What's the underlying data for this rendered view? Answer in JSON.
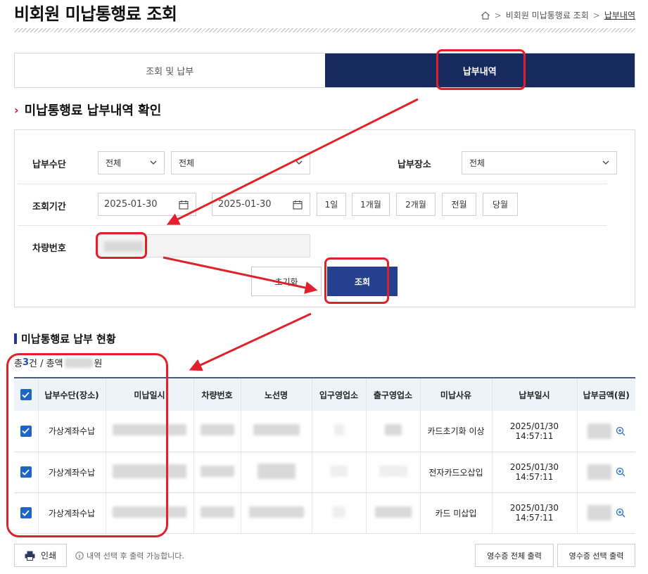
{
  "header": {
    "title": "비회원 미납통행료 조회",
    "breadcrumb": [
      "비회원 미납통행료 조회",
      "납부내역"
    ]
  },
  "tabs": [
    {
      "label": "조회 및 납부",
      "active": false
    },
    {
      "label": "납부내역",
      "active": true
    }
  ],
  "section_title": "미납통행료 납부내역 확인",
  "search": {
    "payment_method_label": "납부수단",
    "payment_method_value1": "전체",
    "payment_method_value2": "전체",
    "payment_place_label": "납부장소",
    "payment_place_value": "전체",
    "period_label": "조회기간",
    "date_from": "2025-01-30",
    "date_to": "2025-01-30",
    "period_buttons": [
      "1일",
      "1개월",
      "2개월",
      "전월",
      "당월"
    ],
    "vehicle_label": "차량번호",
    "reset_label": "초기화",
    "search_label": "조회"
  },
  "results": {
    "title": "미납통행료 납부 현황",
    "summary_prefix": "총 ",
    "summary_count": "3",
    "summary_mid": "건 / 총액",
    "summary_suffix": "원",
    "columns": [
      "납부수단(장소)",
      "미납일시",
      "차량번호",
      "노선명",
      "입구영업소",
      "출구영업소",
      "미납사유",
      "납부일시",
      "납부금액(원)"
    ],
    "rows": [
      {
        "method": "가상계좌수납",
        "reason": "카드초기화 이상",
        "paid_at": "2025/01/30 14:57:11"
      },
      {
        "method": "가상계좌수납",
        "reason": "전자카드오삽입",
        "paid_at": "2025/01/30 14:57:11"
      },
      {
        "method": "가상계좌수납",
        "reason": "카드 미삽입",
        "paid_at": "2025/01/30 14:57:11"
      }
    ]
  },
  "footer": {
    "print_label": "인쇄",
    "note": "내역 선택 후 출력 가능합니다.",
    "receipt_all_label": "영수증 전체 출력",
    "receipt_selected_label": "영수증 선택 출력"
  },
  "colors": {
    "active_tab": "#172a5e",
    "search_button": "#25408f",
    "checkbox": "#1f65c4",
    "annotation": "#e0202a"
  }
}
